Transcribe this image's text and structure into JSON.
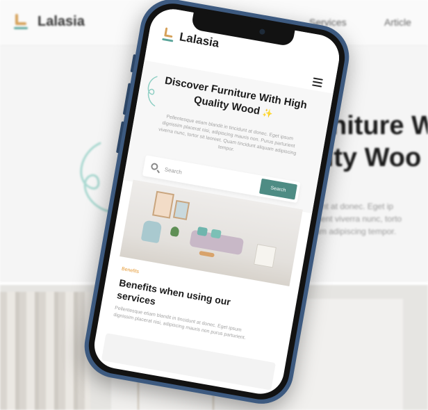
{
  "background_site": {
    "brand": "Lalasia",
    "nav": [
      "Services",
      "Article"
    ],
    "hero_title_lines": [
      "urniture W",
      "ality Woo"
    ],
    "hero_text_lines": [
      "tincidunt at donec. Eget ip",
      "parturient viverra nunc, torto",
      "aliquam adipiscing tempor."
    ]
  },
  "mobile": {
    "brand": "Lalasia",
    "hero": {
      "title": "Discover Furniture With High Quality Wood",
      "sparkle": "✨",
      "description": "Pellentesque etiam blandit in tincidunt at donec. Eget ipsum dignissim placerat nisi, adipiscing mauris non. Purus parturient viverra nunc, tortor sit laoreet. Quam tincidunt aliquam adipiscing tempor."
    },
    "search": {
      "placeholder": "Search",
      "button": "Search"
    },
    "benefits": {
      "tag": "Benefits",
      "title": "Benefits when using our services",
      "description": "Pellentesque etiam blandit in tincidunt at donec. Eget ipsum dignissim placerat nisi, adipiscing mauris non purus parturient."
    }
  },
  "colors": {
    "accent": "#4e8c84",
    "phone_frame": "#3d5a80",
    "tag": "#e59a35",
    "logo_gold": "#d6a15a",
    "logo_teal": "#5aa59a"
  },
  "icons": [
    "chair-logo-icon",
    "hamburger-menu-icon",
    "search-icon",
    "sparkle-icon",
    "swirl-decoration-icon"
  ]
}
